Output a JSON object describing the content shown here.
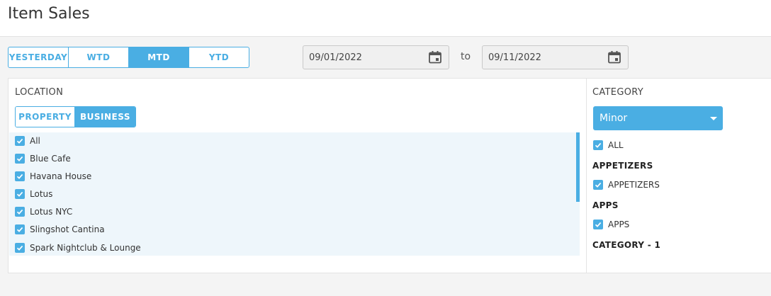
{
  "page": {
    "title": "Item Sales"
  },
  "period": {
    "options": [
      "YESTERDAY",
      "WTD",
      "MTD",
      "YTD"
    ],
    "selected": "MTD"
  },
  "date_range": {
    "from": "09/01/2022",
    "separator": "to",
    "to": "09/11/2022"
  },
  "location": {
    "label": "LOCATION",
    "scope_options": [
      "PROPERTY",
      "BUSINESS"
    ],
    "scope_selected": "BUSINESS",
    "items": [
      {
        "label": "All",
        "checked": true
      },
      {
        "label": "Blue Cafe",
        "checked": true
      },
      {
        "label": "Havana House",
        "checked": true
      },
      {
        "label": "Lotus",
        "checked": true
      },
      {
        "label": "Lotus NYC",
        "checked": true
      },
      {
        "label": "Slingshot Cantina",
        "checked": true
      },
      {
        "label": "Spark Nightclub & Lounge",
        "checked": true
      }
    ]
  },
  "category": {
    "label": "CATEGORY",
    "select_value": "Minor",
    "all_label": "ALL",
    "groups": [
      {
        "heading": "APPETIZERS",
        "item": "APPETIZERS"
      },
      {
        "heading": "APPS",
        "item": "APPS"
      },
      {
        "heading": "CATEGORY - 1"
      }
    ]
  },
  "colors": {
    "accent": "#4aaee3",
    "list_bg": "#eef6fb",
    "page_bg": "#f4f4f4"
  },
  "icons": {
    "calendar": "calendar-icon",
    "checkbox": "check-icon",
    "dropdown": "chevron-down-icon"
  }
}
